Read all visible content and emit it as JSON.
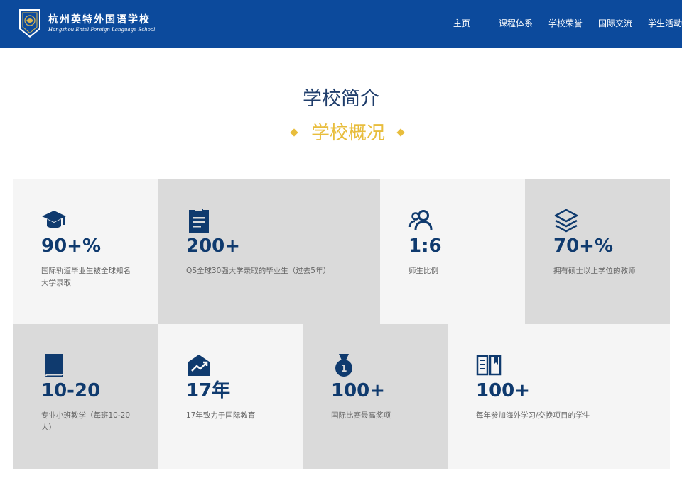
{
  "header": {
    "school_name_cn": "杭州英特外国语学校",
    "school_name_en": "Hangzhou Entel Foreign Language School",
    "nav": [
      "主页",
      "课程体系",
      "学校荣誉",
      "国际交流",
      "学生活动"
    ]
  },
  "section": {
    "title": "学校简介",
    "subtitle": "学校概况"
  },
  "stats": [
    {
      "icon": "graduation-cap-icon",
      "value": "90+%",
      "desc": "国际轨道毕业生被全球知名大学录取"
    },
    {
      "icon": "clipboard-icon",
      "value": "200+",
      "desc": "QS全球30强大学录取的毕业生（过去5年）"
    },
    {
      "icon": "users-icon",
      "value": "1:6",
      "desc": "师生比例"
    },
    {
      "icon": "layers-icon",
      "value": "70+%",
      "desc": "拥有硕士以上学位的教师"
    },
    {
      "icon": "book-icon",
      "value": "10-20",
      "desc": "专业小班教学（每班10-20人）"
    },
    {
      "icon": "growth-house-icon",
      "value": "17年",
      "desc": "17年致力于国际教育"
    },
    {
      "icon": "medal-icon",
      "value": "100+",
      "desc": "国际比赛最高奖项"
    },
    {
      "icon": "open-book-icon",
      "value": "100+",
      "desc": "每年参加海外学习/交换项目的学生"
    }
  ],
  "colors": {
    "header_bg": "#0c4a9c",
    "title": "#1f3d6b",
    "accent_gold": "#e8bd3c",
    "number": "#0f3a6e",
    "card_light": "#f5f5f5",
    "card_dark": "#dadada"
  }
}
